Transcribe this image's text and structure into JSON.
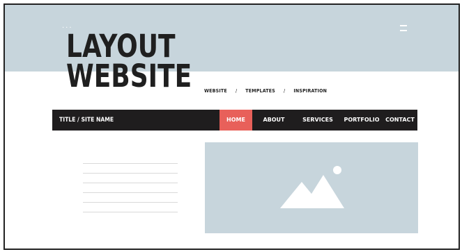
{
  "header": {
    "dots": "...",
    "title_line1": "LAYOUT",
    "title_line2": "WEBSITE"
  },
  "breadcrumb": {
    "items": [
      "WEBSITE",
      "TEMPLATES",
      "INSPIRATION"
    ],
    "separator": "/"
  },
  "nav": {
    "site_name": "TITLE / SITE NAME",
    "items": [
      {
        "label": "HOME",
        "active": true
      },
      {
        "label": "ABOUT",
        "active": false
      },
      {
        "label": "SERVICES",
        "active": false
      },
      {
        "label": "PORTFOLIO",
        "active": false
      },
      {
        "label": "CONTACT",
        "active": false
      }
    ]
  },
  "content": {
    "text_line_count": 6,
    "image_icon": "mountain-image-icon"
  },
  "colors": {
    "hero_bg": "#c7d5dc",
    "nav_bg": "#1f1d1e",
    "active_accent": "#e8605a",
    "title_text": "#1f1f1f"
  }
}
